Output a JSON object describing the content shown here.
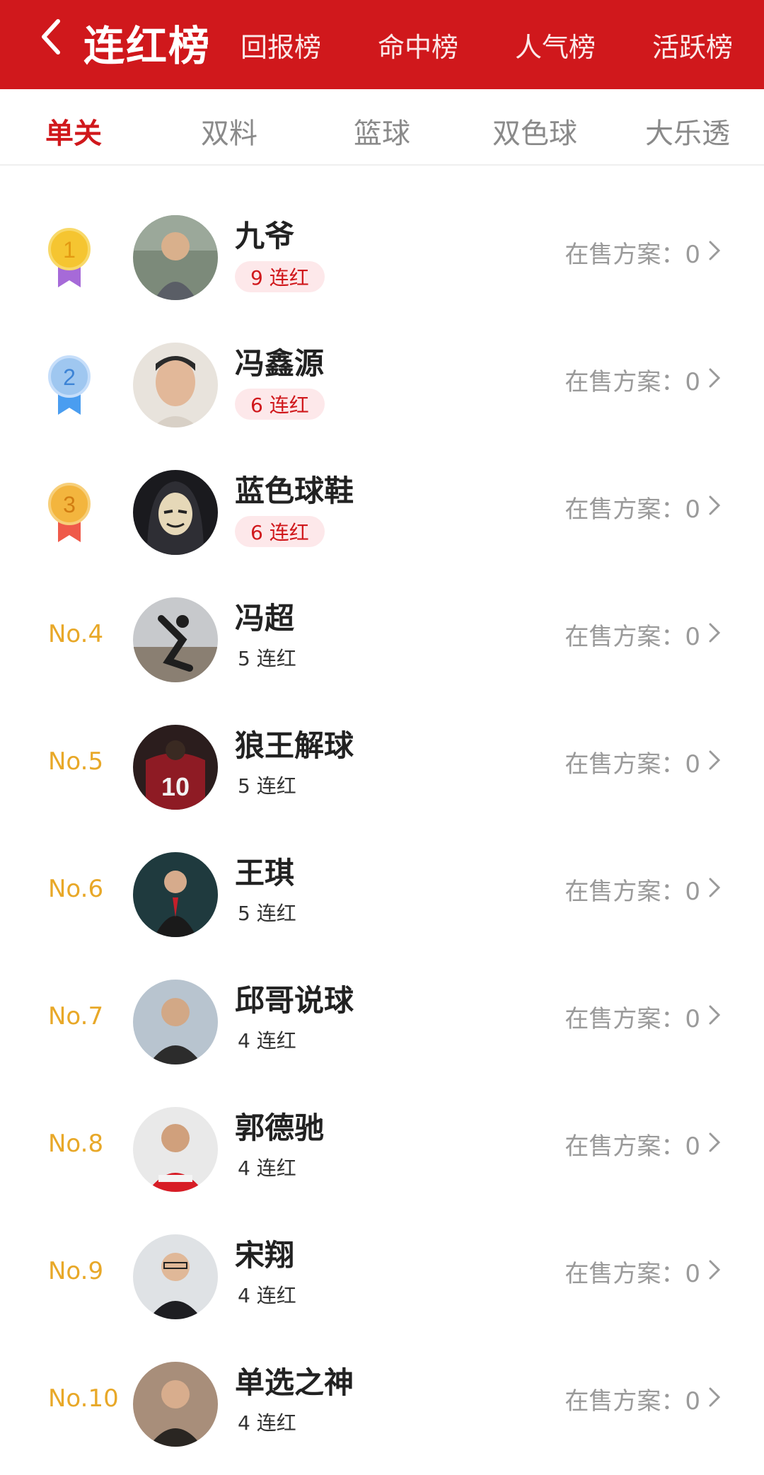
{
  "header": {
    "title": "连红榜",
    "tabs": [
      "回报榜",
      "命中榜",
      "人气榜",
      "活跃榜"
    ]
  },
  "subtabs": {
    "items": [
      "单关",
      "双料",
      "篮球",
      "双色球",
      "大乐透"
    ],
    "active_index": 0
  },
  "colors": {
    "brand_red": "#d0181c",
    "rank_gold": "#e8a828",
    "medal_1": "#f5c531",
    "medal_2": "#9fc7f0",
    "medal_3": "#f3b53e"
  },
  "list": {
    "sale_label": "在售方案：0",
    "items": [
      {
        "rank": "1",
        "name": "九爷",
        "streak": "9 连红"
      },
      {
        "rank": "2",
        "name": "冯鑫源",
        "streak": "6 连红"
      },
      {
        "rank": "3",
        "name": "蓝色球鞋",
        "streak": "6 连红"
      },
      {
        "rank": "No.4",
        "name": "冯超",
        "streak": "5 连红"
      },
      {
        "rank": "No.5",
        "name": "狼王解球",
        "streak": "5 连红"
      },
      {
        "rank": "No.6",
        "name": "王琪",
        "streak": "5 连红"
      },
      {
        "rank": "No.7",
        "name": "邱哥说球",
        "streak": "4 连红"
      },
      {
        "rank": "No.8",
        "name": "郭德驰",
        "streak": "4 连红"
      },
      {
        "rank": "No.9",
        "name": "宋翔",
        "streak": "4 连红"
      },
      {
        "rank": "No.10",
        "name": "单选之神",
        "streak": "4 连红"
      }
    ]
  }
}
